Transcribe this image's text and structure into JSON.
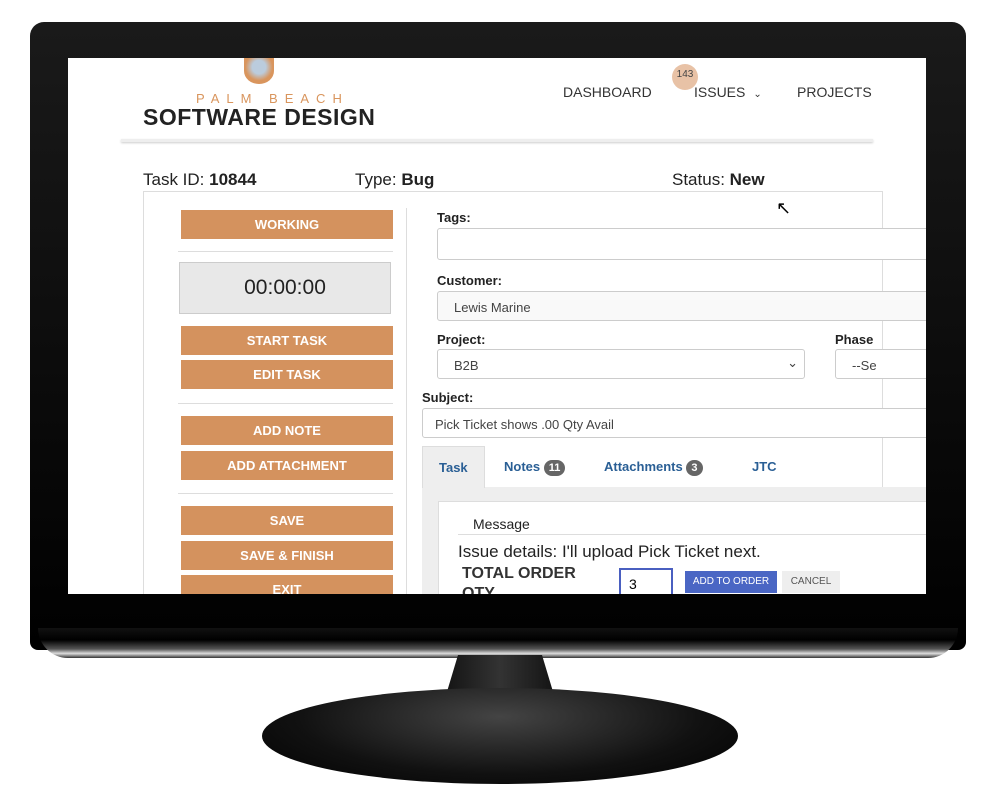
{
  "logo": {
    "line1": "PALM BEACH",
    "line2": "SOFTWARE DESIGN"
  },
  "nav": {
    "dashboard": "DASHBOARD",
    "issues": "ISSUES",
    "issues_badge": "143",
    "projects": "PROJECTS"
  },
  "task": {
    "id_label": "Task ID:",
    "id": "10844",
    "type_label": "Type:",
    "type": "Bug",
    "status_label": "Status:",
    "status": "New"
  },
  "sidebar": {
    "working": "WORKING",
    "timer": "00:00:00",
    "start": "START TASK",
    "edit": "EDIT TASK",
    "add_note": "ADD NOTE",
    "add_attachment": "ADD ATTACHMENT",
    "save": "SAVE",
    "save_finish": "SAVE & FINISH",
    "exit": "EXIT"
  },
  "form": {
    "tags_label": "Tags:",
    "tags": "",
    "customer_label": "Customer:",
    "customer": "Lewis Marine",
    "project_label": "Project:",
    "project": "B2B",
    "phase_label": "Phase",
    "phase": "--Se",
    "subject_label": "Subject:",
    "subject": "Pick Ticket shows .00 Qty Avail"
  },
  "tabs": [
    {
      "label": "Task"
    },
    {
      "label": "Notes",
      "count": "11"
    },
    {
      "label": "Attachments",
      "count": "3"
    },
    {
      "label": "JTC"
    }
  ],
  "message": {
    "header": "Message",
    "text": "Issue details: I'll upload Pick Ticket next.",
    "qty_label": "TOTAL ORDER QTY",
    "qty": "3",
    "add": "ADD TO ORDER",
    "cancel": "CANCEL"
  }
}
